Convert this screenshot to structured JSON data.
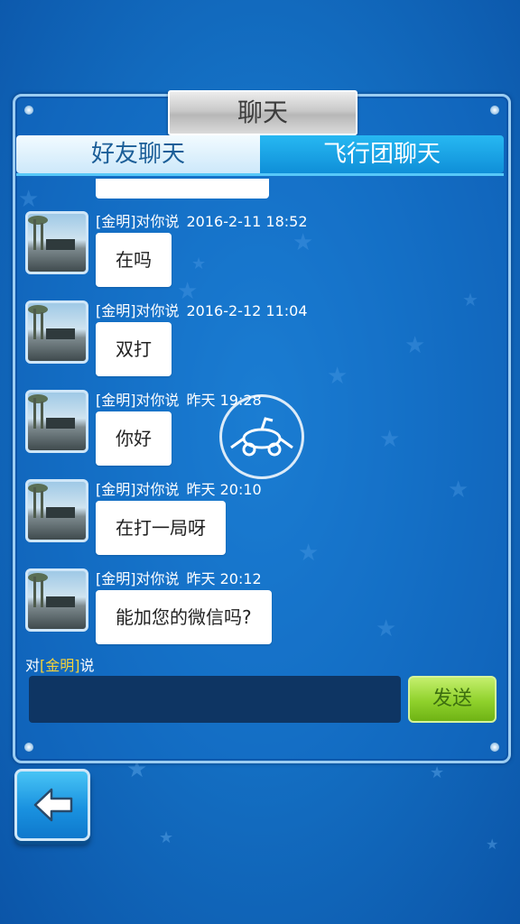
{
  "title": "聊天",
  "tabs": [
    {
      "label": "好友聊天",
      "active": true
    },
    {
      "label": "飞行团聊天",
      "active": false
    }
  ],
  "messages": [
    {
      "sender": "[金明]对你说",
      "time": "2016-2-11 18:52",
      "text": "在吗"
    },
    {
      "sender": "[金明]对你说",
      "time": "2016-2-12 11:04",
      "text": "双打"
    },
    {
      "sender": "[金明]对你说",
      "time": "昨天 19:28",
      "text": "你好"
    },
    {
      "sender": "[金明]对你说",
      "time": "昨天 20:10",
      "text": "在打一局呀"
    },
    {
      "sender": "[金明]对你说",
      "time": "昨天 20:12",
      "text": "能加您的微信吗?"
    }
  ],
  "compose": {
    "prefix": "对",
    "target": "[金明]",
    "suffix": "说",
    "input_value": "",
    "send_label": "发送"
  },
  "icons": {
    "back": "back-arrow-icon",
    "watermark": "airplane-logo-icon"
  },
  "colors": {
    "background": "#1470c4",
    "send_button": "#8fd12b",
    "highlight_name": "#f5d23a",
    "input_background": "#0e3563"
  }
}
